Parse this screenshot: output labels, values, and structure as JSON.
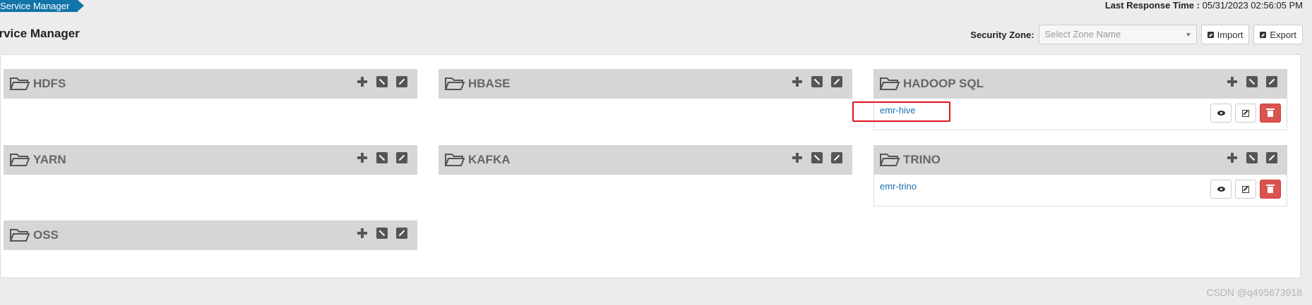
{
  "breadcrumb": {
    "label": "Service Manager"
  },
  "header": {
    "last_response_label": "Last Response Time :",
    "last_response_value": "05/31/2023 02:56:05 PM",
    "title": "ervice Manager"
  },
  "toolbar": {
    "zone_label": "Security Zone:",
    "zone_placeholder": "Select Zone Name",
    "import_label": "Import",
    "export_label": "Export"
  },
  "services": [
    {
      "name": "HDFS",
      "items": []
    },
    {
      "name": "HBASE",
      "items": []
    },
    {
      "name": "HADOOP SQL",
      "items": [
        "emr-hive"
      ]
    },
    {
      "name": "YARN",
      "items": []
    },
    {
      "name": "KAFKA",
      "items": []
    },
    {
      "name": "TRINO",
      "items": [
        "emr-trino"
      ]
    },
    {
      "name": "OSS",
      "items": []
    }
  ],
  "icons": {
    "folder": "folder-open-icon",
    "add": "plus-icon",
    "edit": "edit-square-icon",
    "export": "external-link-icon",
    "view": "eye-icon",
    "edit_row": "pencil-icon",
    "delete": "trash-icon"
  },
  "colors": {
    "accent": "#1274a8",
    "link": "#1a6fb0",
    "danger": "#d9534f",
    "highlight": "#e0161c"
  },
  "watermark": "CSDN @q495673918"
}
